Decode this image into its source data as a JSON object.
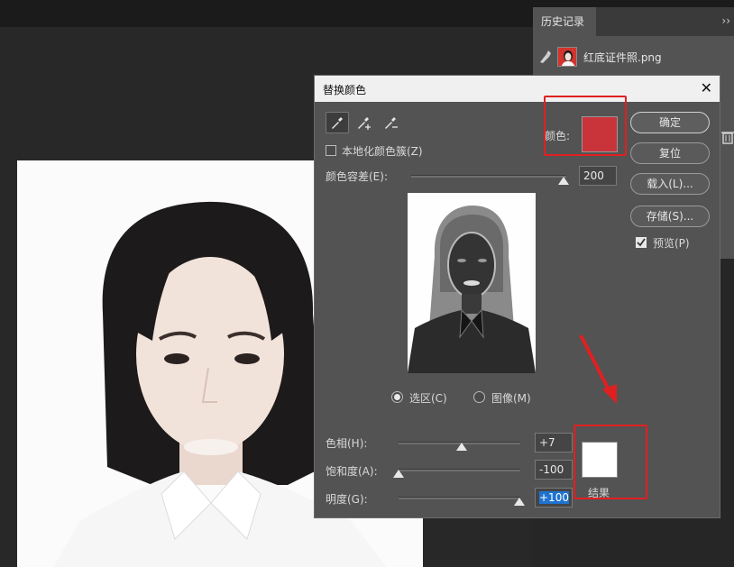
{
  "history_panel": {
    "tab_label": "历史记录",
    "collapse_glyph": "››",
    "snapshot_name": "红底证件照.png"
  },
  "dialog": {
    "title": "替换颜色",
    "close_glyph": "✕",
    "localized_clusters_label": "本地化颜色簇(Z)",
    "localized_clusters_checked": false,
    "fuzziness_label": "颜色容差(E):",
    "fuzziness_value": "200",
    "color_label": "颜色:",
    "selected_color": "#c8343a",
    "radio_selection_label": "选区(C)",
    "radio_image_label": "图像(M)",
    "selected_radio": "selection",
    "hue_label": "色相(H):",
    "hue_value": "+7",
    "saturation_label": "饱和度(A):",
    "saturation_value": "-100",
    "lightness_label": "明度(G):",
    "lightness_value": "+100",
    "result_label": "结果",
    "result_color": "#ffffff",
    "buttons": {
      "ok": "确定",
      "reset": "复位",
      "load": "载入(L)...",
      "save": "存储(S)..."
    },
    "preview_label": "预览(P)",
    "preview_checked": true
  },
  "annotation_color": "#e02020"
}
